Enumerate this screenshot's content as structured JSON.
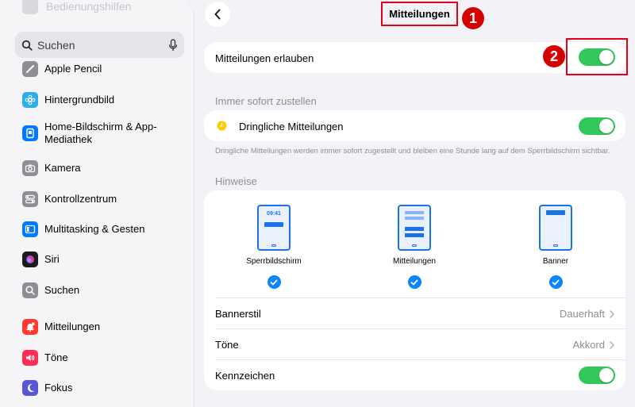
{
  "sidebar": {
    "faded_item": "Bedienungshilfen",
    "search": {
      "placeholder": "Suchen"
    },
    "items": [
      {
        "label": "Apple Pencil",
        "color": "#8e8e93"
      },
      {
        "label": "Hintergrundbild",
        "color": "#32ade6"
      },
      {
        "label": "Home-Bildschirm & App-Mediathek",
        "color": "#007aff"
      },
      {
        "label": "Kamera",
        "color": "#8e8e93"
      },
      {
        "label": "Kontrollzentrum",
        "color": "#8e8e93"
      },
      {
        "label": "Multitasking & Gesten",
        "color": "#007aff"
      },
      {
        "label": "Siri",
        "color": "#1c1c1e"
      },
      {
        "label": "Suchen",
        "color": "#8e8e93"
      },
      {
        "label": "Mitteilungen",
        "color": "#ff3b30"
      },
      {
        "label": "Töne",
        "color": "#ff2d55"
      },
      {
        "label": "Fokus",
        "color": "#5856d6"
      }
    ]
  },
  "header": {
    "title": "Mitteilungen",
    "badge1": "1",
    "badge2": "2"
  },
  "allow": {
    "label": "Mitteilungen erlauben",
    "on": true
  },
  "immediate": {
    "section": "Immer sofort zustellen",
    "row_label": "Dringliche Mitteilungen",
    "on": true,
    "footnote": "Dringliche Mitteilungen werden immer sofort zugestellt und bleiben eine Stunde lang auf dem Sperrbildschirm sichtbar."
  },
  "alerts": {
    "section": "Hinweise",
    "options": [
      {
        "label": "Sperrbildschirm",
        "time": "09:41",
        "checked": true
      },
      {
        "label": "Mitteilungen",
        "checked": true
      },
      {
        "label": "Banner",
        "checked": true
      }
    ],
    "banner_style": {
      "label": "Bannerstil",
      "value": "Dauerhaft"
    },
    "sounds": {
      "label": "Töne",
      "value": "Akkord"
    },
    "badges": {
      "label": "Kennzeichen",
      "on": true
    }
  },
  "colors": {
    "accent": "#0a84ff",
    "toggle_on": "#34c759",
    "highlight": "#e2001a"
  }
}
